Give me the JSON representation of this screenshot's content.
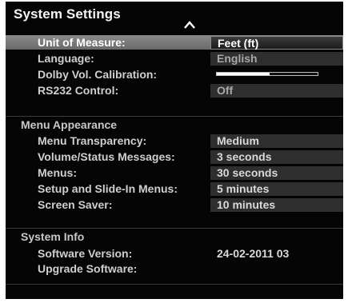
{
  "title": "System Settings",
  "scroll_indicator": "up-caret-icon",
  "rows_top": [
    {
      "label": "Unit of Measure:",
      "value": "Feet (ft)",
      "selected": true
    },
    {
      "label": "Language:",
      "value": "English"
    },
    {
      "label": "Dolby Vol. Calibration:",
      "slider_level": 0.52
    },
    {
      "label": "RS232 Control:",
      "value": "Off"
    }
  ],
  "menu_appearance": {
    "title": "Menu Appearance",
    "rows": [
      {
        "label": "Menu Transparency:",
        "value": "Medium"
      },
      {
        "label": "Volume/Status Messages:",
        "value": "3 seconds"
      },
      {
        "label": "Menus:",
        "value": "30 seconds"
      },
      {
        "label": "Setup and Slide-In Menus:",
        "value": "5 minutes"
      },
      {
        "label": "Screen Saver:",
        "value": "10 minutes"
      }
    ]
  },
  "system_info": {
    "title": "System Info",
    "rows": [
      {
        "label": "Software Version:",
        "value": "24-02-2011 03"
      },
      {
        "label": "Upgrade Software:",
        "value": ""
      }
    ]
  },
  "colors": {
    "background": "#050505",
    "selected_row": "#7a7a7a",
    "value_cell": "#2e2e2e",
    "text": "#cfcfcf"
  }
}
